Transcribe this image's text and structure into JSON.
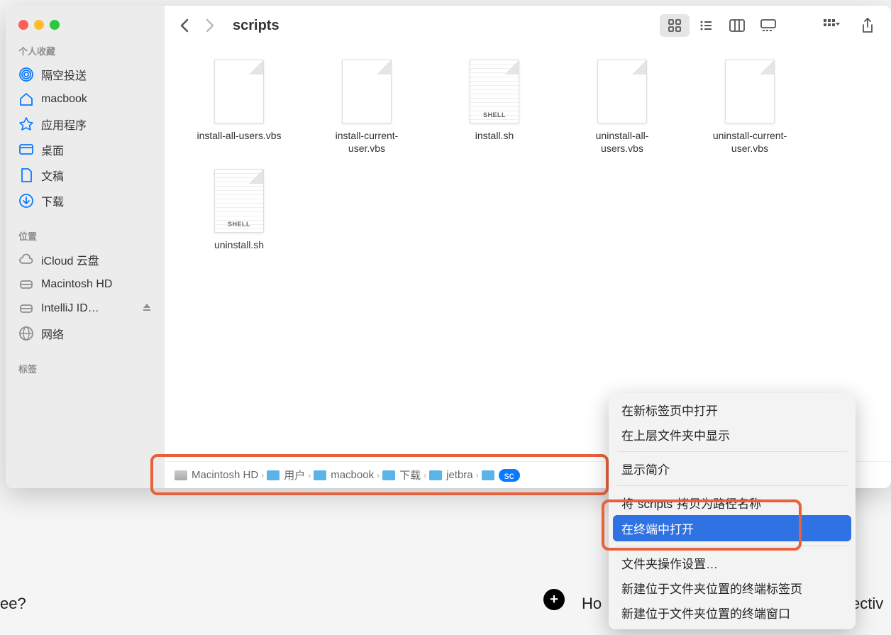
{
  "window": {
    "title": "scripts"
  },
  "sidebar": {
    "sections": [
      {
        "heading": "个人收藏",
        "items": [
          {
            "label": "隔空投送",
            "icon": "airdrop"
          },
          {
            "label": "macbook",
            "icon": "home"
          },
          {
            "label": "应用程序",
            "icon": "apps"
          },
          {
            "label": "桌面",
            "icon": "desktop"
          },
          {
            "label": "文稿",
            "icon": "doc"
          },
          {
            "label": "下载",
            "icon": "download"
          }
        ]
      },
      {
        "heading": "位置",
        "items": [
          {
            "label": "iCloud 云盘",
            "icon": "cloud"
          },
          {
            "label": "Macintosh HD",
            "icon": "disk"
          },
          {
            "label": "IntelliJ ID…",
            "icon": "disk",
            "eject": true
          },
          {
            "label": "网络",
            "icon": "globe"
          }
        ]
      },
      {
        "heading": "标签",
        "items": []
      }
    ]
  },
  "files": [
    {
      "name": "install-all-users.vbs",
      "type": "blank"
    },
    {
      "name": "install-current-user.vbs",
      "type": "blank"
    },
    {
      "name": "install.sh",
      "type": "shell",
      "badge": "SHELL"
    },
    {
      "name": "uninstall-all-users.vbs",
      "type": "blank"
    },
    {
      "name": "uninstall-current-user.vbs",
      "type": "blank"
    },
    {
      "name": "uninstall.sh",
      "type": "shell",
      "badge": "SHELL"
    }
  ],
  "pathbar": [
    {
      "label": "Macintosh HD",
      "icon": "disk"
    },
    {
      "label": "用户",
      "icon": "blue"
    },
    {
      "label": "macbook",
      "icon": "blue"
    },
    {
      "label": "下载",
      "icon": "blue"
    },
    {
      "label": "jetbra",
      "icon": "blue2"
    },
    {
      "label": "sc",
      "icon": "blue2",
      "selected": true
    }
  ],
  "context_menu": {
    "groups": [
      [
        "在新标签页中打开",
        "在上层文件夹中显示"
      ],
      [
        "显示简介"
      ],
      [
        "将\"scripts\"拷贝为路径名称",
        "在终端中打开"
      ],
      [
        "文件夹操作设置…",
        "新建位于文件夹位置的终端标签页",
        "新建位于文件夹位置的终端窗口"
      ]
    ],
    "highlighted": "在终端中打开"
  },
  "bg": {
    "left": "ee?",
    "right": "Ho",
    "right2": "ectiv"
  }
}
